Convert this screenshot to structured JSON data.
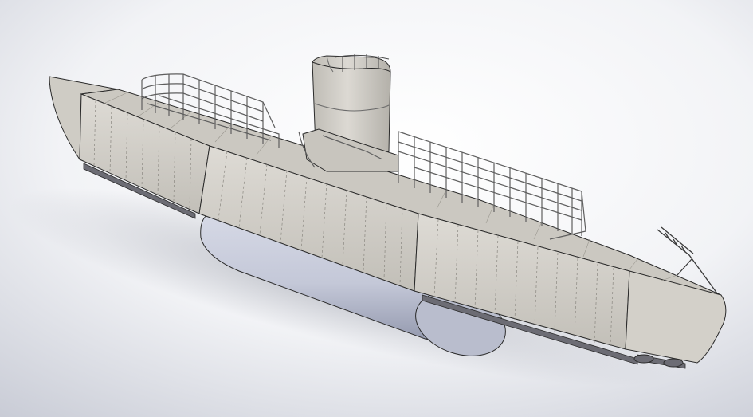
{
  "viewport": {
    "background_top": "#ffffff",
    "background_bottom": "#c9ccd6"
  },
  "model": {
    "subject": "submarine-model",
    "hull_color": "#d5d2cc",
    "hull_shadow_color": "#a8a59f",
    "tank_color": "#c4c8d8",
    "tank_shadow_color": "#8a90a6",
    "edge_color": "#2a2a2a",
    "rail_color": "#6a6a6a",
    "deck_color": "#c9c6bf"
  }
}
